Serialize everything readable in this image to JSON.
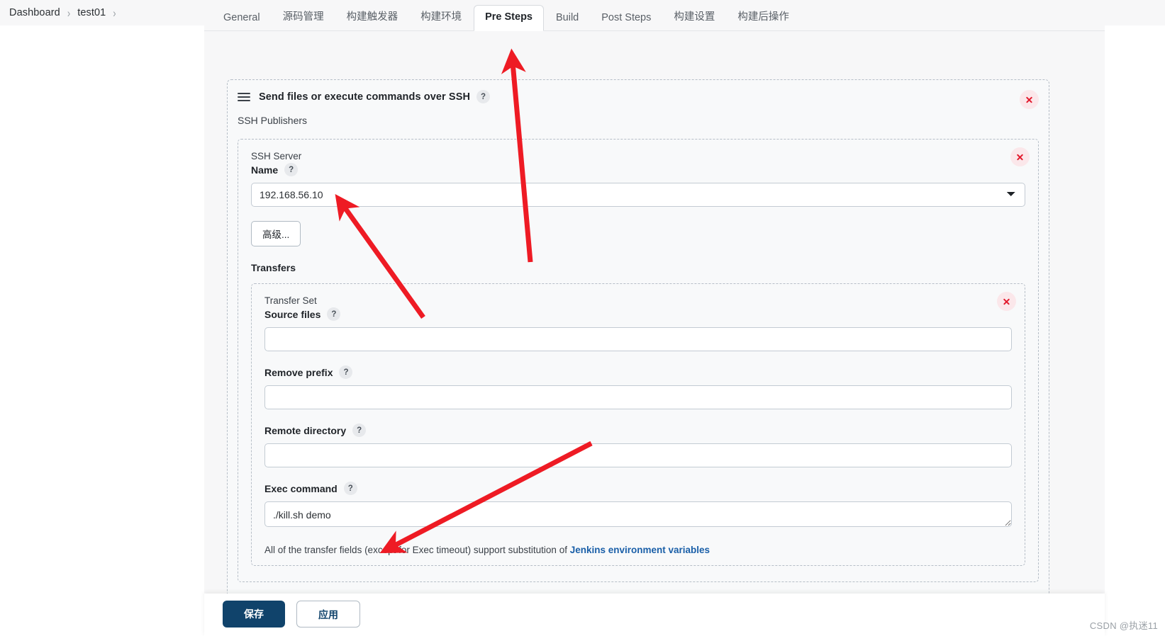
{
  "breadcrumb": {
    "items": [
      "Dashboard",
      "test01"
    ],
    "separator": "›"
  },
  "tabs": [
    {
      "label": "General",
      "active": false
    },
    {
      "label": "源码管理",
      "active": false
    },
    {
      "label": "构建触发器",
      "active": false
    },
    {
      "label": "构建环境",
      "active": false
    },
    {
      "label": "Pre Steps",
      "active": true
    },
    {
      "label": "Build",
      "active": false
    },
    {
      "label": "Post Steps",
      "active": false
    },
    {
      "label": "构建设置",
      "active": false
    },
    {
      "label": "构建后操作",
      "active": false
    }
  ],
  "panel": {
    "title": "Send files or execute commands over SSH",
    "help": "?",
    "section_label": "SSH Publishers",
    "delete_label": "×"
  },
  "ssh_server": {
    "group_label": "SSH Server",
    "name_label": "Name",
    "name_help": "?",
    "name_value": "192.168.56.10",
    "name_options": [
      "192.168.56.10"
    ],
    "advanced_button": "高级...",
    "transfers_label": "Transfers"
  },
  "transfer_set": {
    "group_label": "Transfer Set",
    "fields": [
      {
        "label": "Source files",
        "help": "?",
        "value": "",
        "placeholder": "",
        "type": "input"
      },
      {
        "label": "Remove prefix",
        "help": "?",
        "value": "",
        "placeholder": "",
        "type": "input"
      },
      {
        "label": "Remote directory",
        "help": "?",
        "value": "",
        "placeholder": "",
        "type": "input"
      },
      {
        "label": "Exec command",
        "help": "?",
        "value": "./kill.sh demo",
        "placeholder": "",
        "type": "textarea"
      }
    ],
    "footnote_prefix": "All of the transfer fields (except for Exec timeout) support substitution of ",
    "footnote_link": "Jenkins environment variables"
  },
  "actions": {
    "save_label": "保存",
    "apply_label": "应用"
  },
  "watermark": "CSDN @执迷11",
  "colors": {
    "accent": "#10436b",
    "danger": "#e2192c",
    "annotation": "#ee1b24",
    "link": "#1a5fa8",
    "panel_bg": "#f8f9fa",
    "chrome_bg": "#f7f7f8"
  }
}
